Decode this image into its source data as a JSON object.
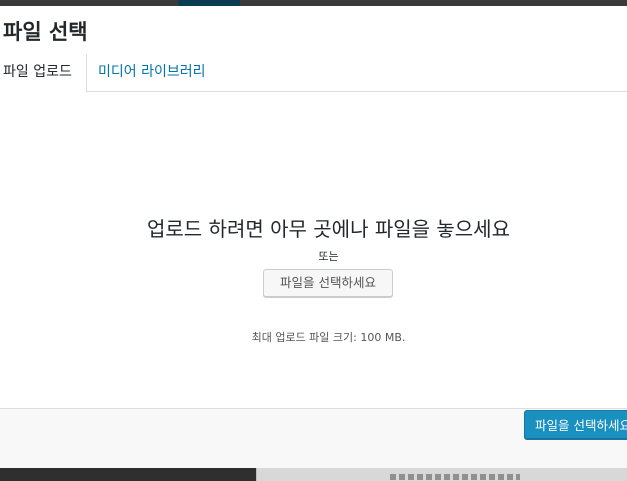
{
  "modal": {
    "title": "파일 선택"
  },
  "router": {
    "tabs": [
      {
        "label": "파일 업로드",
        "active": true
      },
      {
        "label": "미디어 라이브러리",
        "active": false
      }
    ]
  },
  "uploader": {
    "instructions": "업로드 하려면 아무 곳에나 파일을 놓으세요",
    "or_text": "또는",
    "select_button_label": "파일을 선택하세요",
    "max_size_text": "최대 업로드 파일 크기: 100 MB."
  },
  "toolbar": {
    "primary_button_label": "파일을 선택하세요"
  },
  "colors": {
    "accent": "#0085ba",
    "link": "#0073aa",
    "text": "#23282d"
  }
}
